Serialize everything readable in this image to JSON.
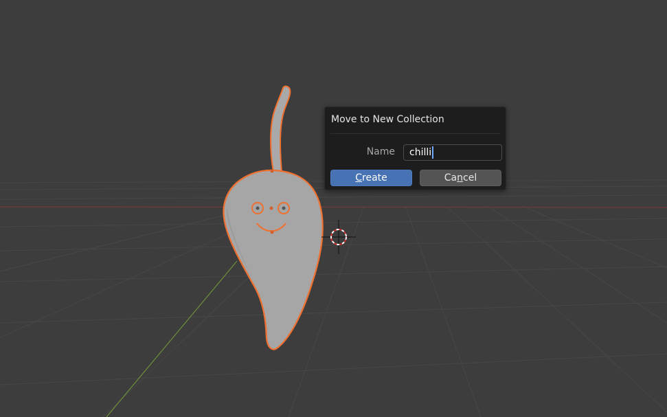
{
  "viewport": {
    "scene_object": "chilli pepper mesh",
    "colors": {
      "background": "#3d3d3d",
      "grid": "#4a4a4a",
      "x_axis": "#8a3a3a",
      "y_axis": "#6e8f3a",
      "selection_outline": "#f07030",
      "mesh": "#a8a8a8"
    }
  },
  "dialog": {
    "title": "Move to New Collection",
    "name_label": "Name",
    "name_value": "chilli",
    "create_label_underlined": "C",
    "create_label_rest": "reate",
    "cancel_label_start": "Ca",
    "cancel_label_underlined": "n",
    "cancel_label_rest": "cel"
  }
}
